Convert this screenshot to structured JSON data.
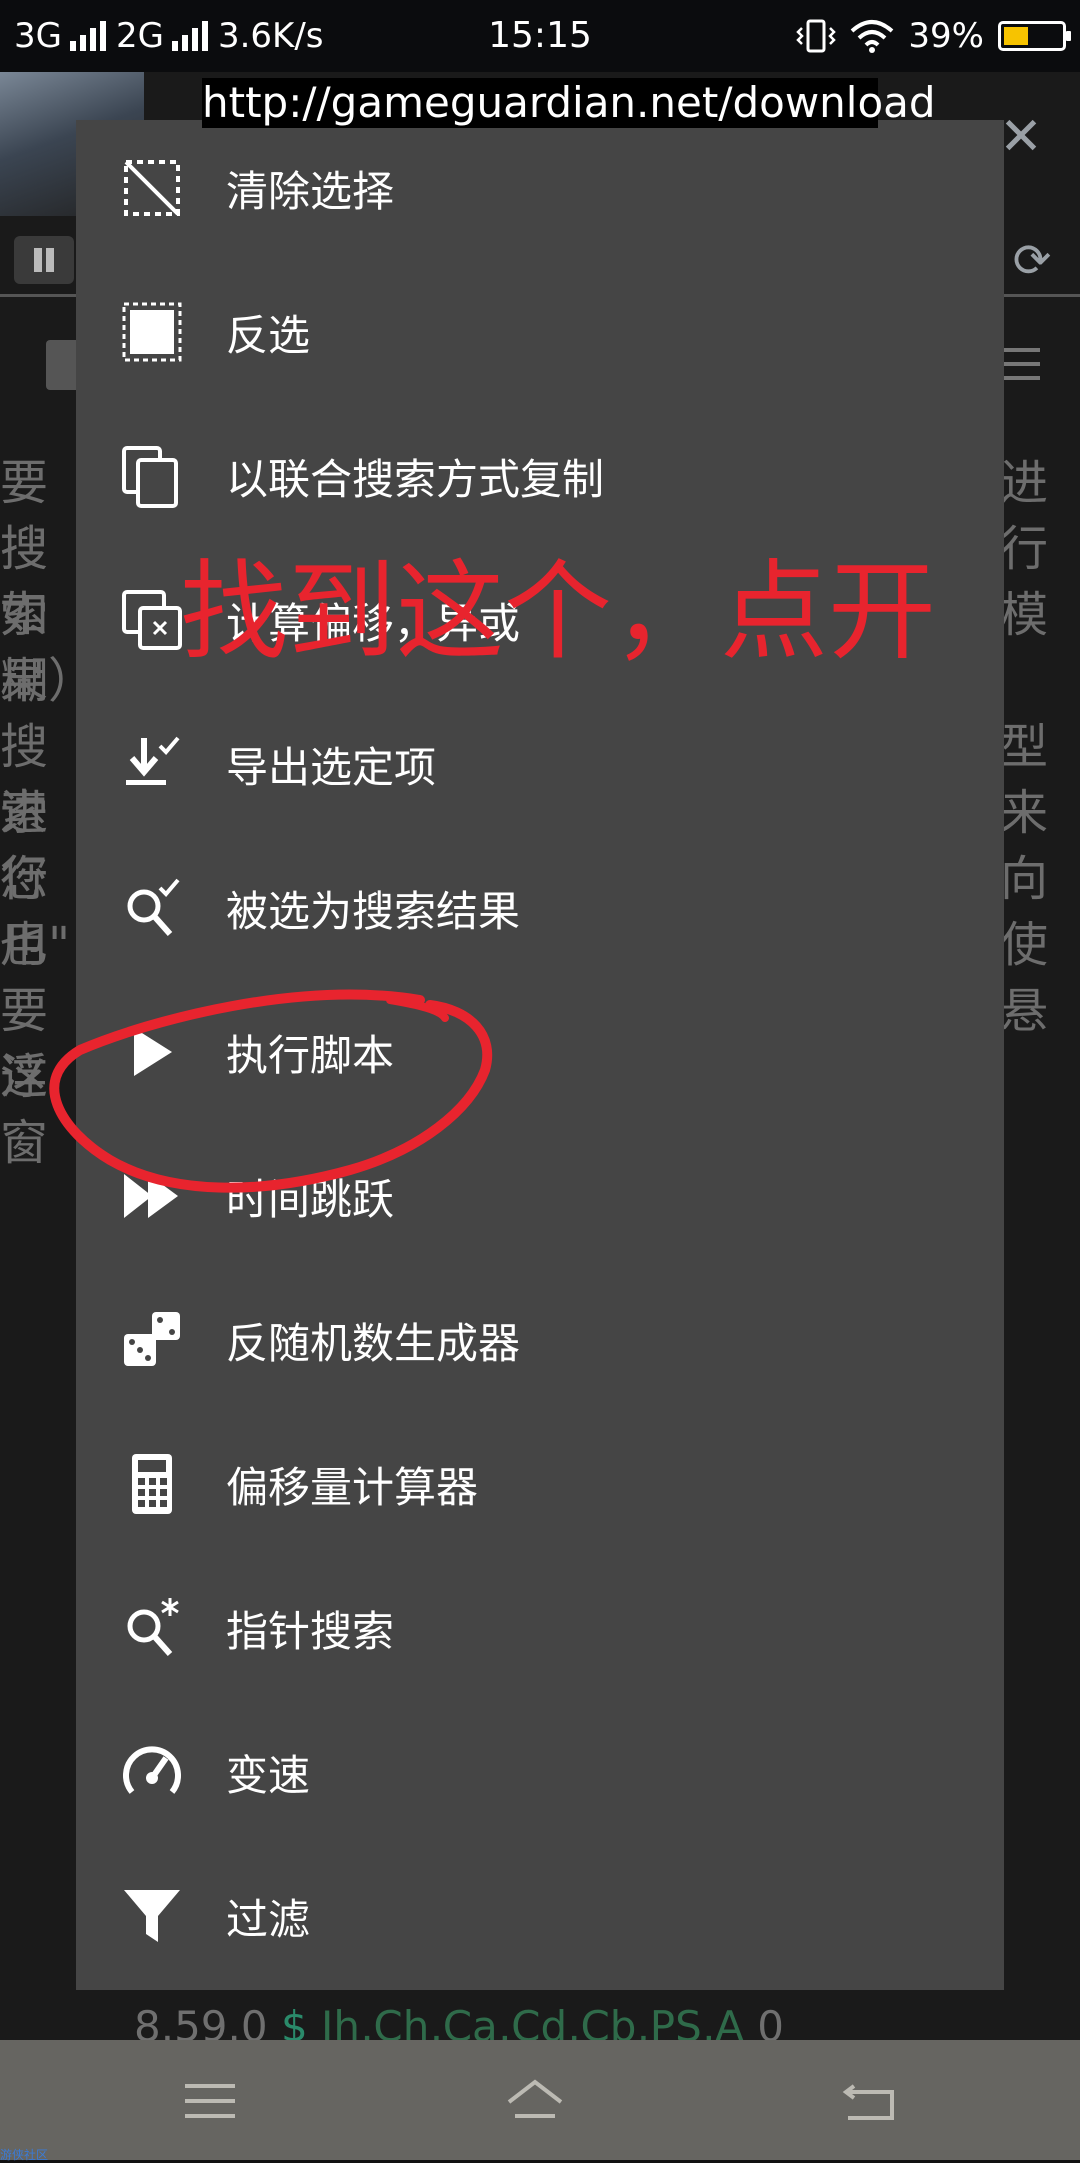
{
  "status_bar": {
    "net1": "3G",
    "net2": "2G",
    "speed": "3.6K/s",
    "time": "15:15",
    "battery": "39%"
  },
  "app": {
    "url": "http://gameguardian.net/download",
    "bg_left_chars": [
      "要搜",
      "搜索",
      "如果",
      "糊）",
      "搜索",
      "进行",
      "您也",
      "用\"",
      "要这",
      "浮窗"
    ],
    "bg_right_chars": [
      "进行",
      "",
      "模",
      "",
      "型来",
      "",
      "向使",
      "",
      "悬",
      ""
    ],
    "bottom_status": {
      "version": "8.59.0",
      "dollar": "$",
      "regions": "Jh,Ch,Ca,Cd,Cb,PS,A",
      "count": "0"
    }
  },
  "menu": {
    "items": [
      {
        "label": "清除选择",
        "icon": "clear-selection-icon"
      },
      {
        "label": "反选",
        "icon": "invert-selection-icon"
      },
      {
        "label": "以联合搜索方式复制",
        "icon": "copy-icon"
      },
      {
        "label": "计算偏移，异或",
        "icon": "offset-calc-icon"
      },
      {
        "label": "导出选定项",
        "icon": "export-icon"
      },
      {
        "label": "被选为搜索结果",
        "icon": "search-check-icon"
      },
      {
        "label": "执行脚本",
        "icon": "play-icon"
      },
      {
        "label": "时间跳跃",
        "icon": "fast-forward-icon"
      },
      {
        "label": "反随机数生成器",
        "icon": "dice-icon"
      },
      {
        "label": "偏移量计算器",
        "icon": "calculator-icon"
      },
      {
        "label": "指针搜索",
        "icon": "pointer-search-icon"
      },
      {
        "label": "变速",
        "icon": "speedometer-icon"
      },
      {
        "label": "过滤",
        "icon": "filter-icon"
      }
    ]
  },
  "annotation": {
    "text": "找到这个，点开",
    "color": "#e8242e"
  },
  "watermark": "游侠社区"
}
